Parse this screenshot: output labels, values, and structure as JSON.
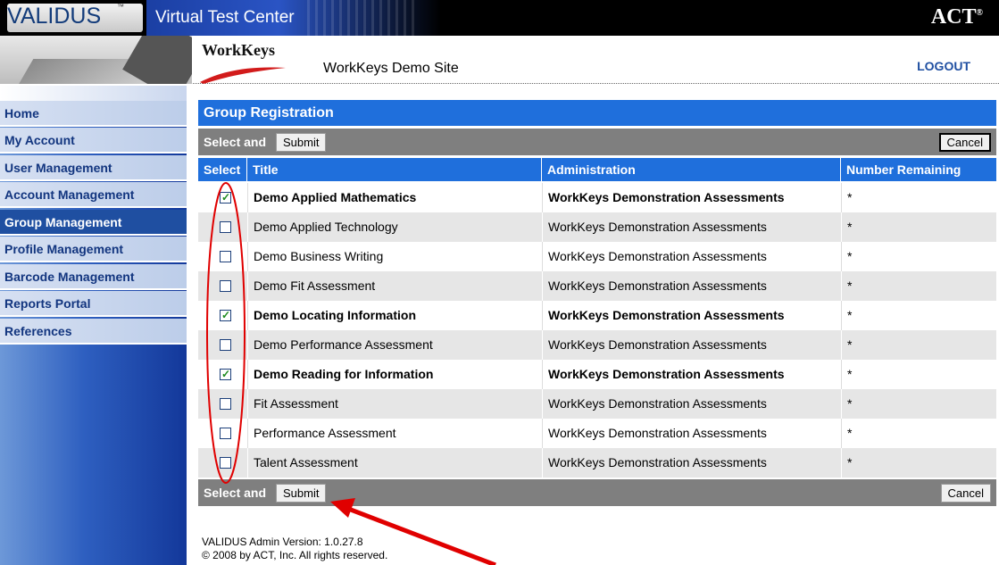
{
  "header": {
    "brand": "VALIDUS",
    "brand_tm": "™",
    "app_title": "Virtual Test Center",
    "act_logo": "ACT",
    "act_reg": "®",
    "workkeys_logo": "WorkKeys",
    "site_title": "WorkKeys Demo Site",
    "logout_label": "LOGOUT"
  },
  "sidebar": {
    "items": [
      {
        "label": "Home"
      },
      {
        "label": "My Account"
      },
      {
        "label": "User Management"
      },
      {
        "label": "Account Management"
      },
      {
        "label": "Group Management",
        "active": true
      },
      {
        "label": "Profile Management"
      },
      {
        "label": "Barcode Management"
      },
      {
        "label": "Reports Portal"
      },
      {
        "label": "References"
      }
    ]
  },
  "panel": {
    "title": "Group Registration",
    "action_label": "Select and",
    "submit_label": "Submit",
    "cancel_label": "Cancel"
  },
  "table": {
    "columns": [
      "Select",
      "Title",
      "Administration",
      "Number Remaining"
    ],
    "rows": [
      {
        "checked": true,
        "title": "Demo Applied Mathematics",
        "administration": "WorkKeys Demonstration Assessments",
        "remaining": "*"
      },
      {
        "checked": false,
        "title": "Demo Applied Technology",
        "administration": "WorkKeys Demonstration Assessments",
        "remaining": "*"
      },
      {
        "checked": false,
        "title": "Demo Business Writing",
        "administration": "WorkKeys Demonstration Assessments",
        "remaining": "*"
      },
      {
        "checked": false,
        "title": "Demo Fit Assessment",
        "administration": "WorkKeys Demonstration Assessments",
        "remaining": "*"
      },
      {
        "checked": true,
        "title": "Demo Locating Information",
        "administration": "WorkKeys Demonstration Assessments",
        "remaining": "*"
      },
      {
        "checked": false,
        "title": "Demo Performance Assessment",
        "administration": "WorkKeys Demonstration Assessments",
        "remaining": "*"
      },
      {
        "checked": true,
        "title": "Demo Reading for Information",
        "administration": "WorkKeys Demonstration Assessments",
        "remaining": "*"
      },
      {
        "checked": false,
        "title": "Fit Assessment",
        "administration": "WorkKeys Demonstration Assessments",
        "remaining": "*"
      },
      {
        "checked": false,
        "title": "Performance Assessment",
        "administration": "WorkKeys Demonstration Assessments",
        "remaining": "*"
      },
      {
        "checked": false,
        "title": "Talent Assessment",
        "administration": "WorkKeys Demonstration Assessments",
        "remaining": "*"
      }
    ]
  },
  "footer": {
    "version": "VALIDUS Admin Version: 1.0.27.8",
    "copyright": "© 2008 by ACT, Inc. All rights reserved."
  },
  "colors": {
    "accent_blue": "#1f6fdc",
    "nav_active": "#1f4fa1",
    "annotation_red": "#e00000"
  },
  "icons": [
    "checkbox-checked-icon",
    "checkbox-unchecked-icon"
  ]
}
